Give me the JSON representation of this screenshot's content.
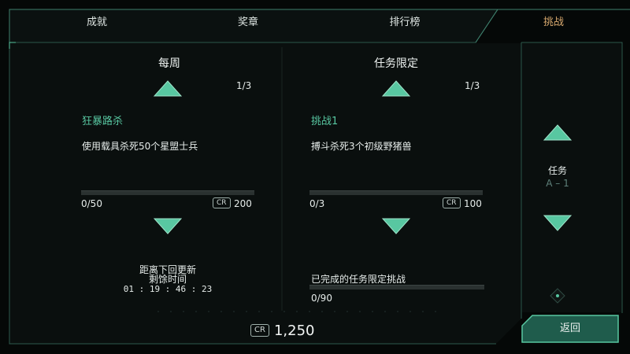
{
  "tabs": [
    {
      "label": "成就",
      "active": false
    },
    {
      "label": "奖章",
      "active": false
    },
    {
      "label": "排行榜",
      "active": false
    },
    {
      "label": "挑战",
      "active": true
    }
  ],
  "weekly": {
    "title": "每周",
    "page": "1/3",
    "challenge_name": "狂暴路杀",
    "description": "使用载具杀死50个星盟士兵",
    "progress_text": "0/50",
    "progress_fraction": 0,
    "reward_badge": "CR",
    "reward": "200",
    "timer_label_line1": "距离下回更新",
    "timer_label_line2": "剩馀时间",
    "timer": "01 : 19 : 46 : 23"
  },
  "mission": {
    "title": "任务限定",
    "page": "1/3",
    "challenge_name": "挑战1",
    "description": "搏斗杀死3个初级野猪兽",
    "progress_text": "0/3",
    "progress_fraction": 0,
    "reward_badge": "CR",
    "reward": "100",
    "completed_label": "已完成的任务限定挑战",
    "completed_text": "0/90",
    "completed_fraction": 0
  },
  "mission_select": {
    "label": "任务",
    "value": "A – 1"
  },
  "footer": {
    "credits_badge": "CR",
    "credits": "1,250",
    "back_label": "返回"
  },
  "colors": {
    "accent": "#58c7a1",
    "active_tab": "#d7a86e",
    "frame_line": "#3e7f6c",
    "background": "#050807"
  }
}
